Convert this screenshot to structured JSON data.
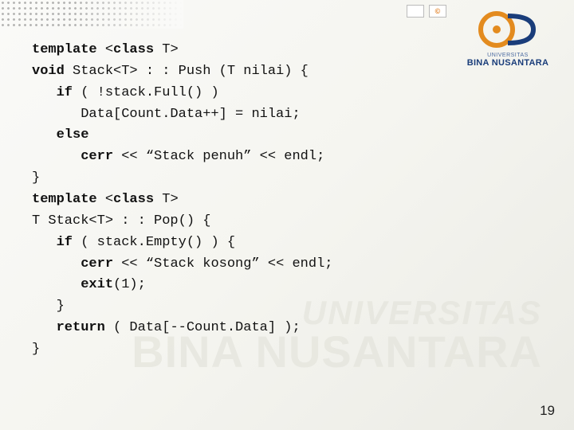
{
  "decor": {
    "dots": true
  },
  "badges": {
    "b1": "",
    "b2": "©"
  },
  "logo": {
    "uni_label": "UNIVERSITAS",
    "name_label": "BINA NUSANTARA"
  },
  "watermark": {
    "line1": "UNIVERSITAS",
    "line2": "BINA NUSANTARA"
  },
  "code": {
    "l1_bold": "template",
    "l1_rest": " <",
    "l1_class": "class",
    "l1_rest2": " T>",
    "l2_bold": "void",
    "l2_rest": " Stack<T> : : Push (T nilai) {",
    "l3_pad": "   ",
    "l3_bold": "if",
    "l3_rest": " ( !stack.Full() )",
    "l4": "      Data[Count.Data++] = nilai;",
    "l5_pad": "   ",
    "l5_bold": "else",
    "l6_pad": "      ",
    "l6_bold": "cerr",
    "l6_rest": " << “Stack penuh” << endl;",
    "l7": "}",
    "l8_bold": "template",
    "l8_rest": " <",
    "l8_class": "class",
    "l8_rest2": " T>",
    "l9": "T Stack<T> : : Pop() {",
    "l10_pad": "   ",
    "l10_bold": "if",
    "l10_rest": " ( stack.Empty() ) {",
    "l11_pad": "      ",
    "l11_bold": "cerr",
    "l11_rest": " << “Stack kosong” << endl;",
    "l12_pad": "      ",
    "l12_bold": "exit",
    "l12_rest": "(1);",
    "l13": "   }",
    "l14_pad": "   ",
    "l14_bold": "return",
    "l14_rest": " ( Data[--Count.Data] );",
    "l15": "}"
  },
  "page_number": "19"
}
